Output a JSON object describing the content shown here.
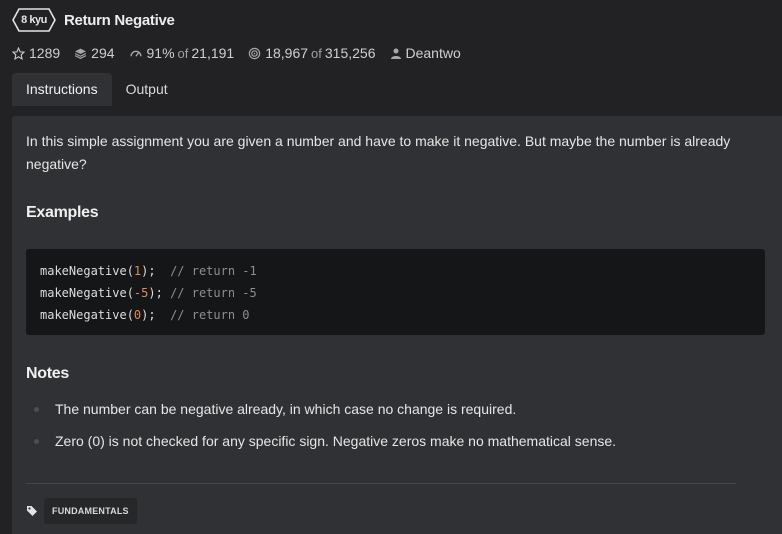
{
  "kata": {
    "rank": "8 kyu",
    "title": "Return Negative"
  },
  "stats": {
    "stars": "1289",
    "collections": "294",
    "satisfaction_pct": "91%",
    "of_word": "of",
    "votes": "21,191",
    "completed": "18,967",
    "attempts": "315,256",
    "author": "Deantwo"
  },
  "tabs": [
    {
      "label": "Instructions",
      "active": true
    },
    {
      "label": "Output",
      "active": false
    }
  ],
  "description": {
    "intro": "In this simple assignment you are given a number and have to make it negative. But maybe the number is already negative?",
    "examples_heading": "Examples",
    "code_lines": [
      {
        "fn": "makeNegative(",
        "arg": "1",
        "close": ");  ",
        "comment": "// return -1"
      },
      {
        "fn": "makeNegative(",
        "arg": "-5",
        "close": "); ",
        "comment": "// return -5"
      },
      {
        "fn": "makeNegative(",
        "arg": "0",
        "close": ");  ",
        "comment": "// return 0"
      }
    ],
    "notes_heading": "Notes",
    "notes": [
      "The number can be negative already, in which case no change is required.",
      "Zero (0) is not checked for any specific sign. Negative zeros make no mathematical sense."
    ]
  },
  "tags": [
    "FUNDAMENTALS"
  ],
  "icons": {
    "star": "star-icon",
    "collection": "stack-icon",
    "satisfaction": "gauge-icon",
    "completed": "target-icon",
    "author": "user-icon",
    "tag": "tag-icon"
  },
  "colors": {
    "background": "#222224",
    "panel": "#303134",
    "code_bg": "#151617",
    "number": "#e08a4f",
    "comment": "#8e8e8e"
  }
}
